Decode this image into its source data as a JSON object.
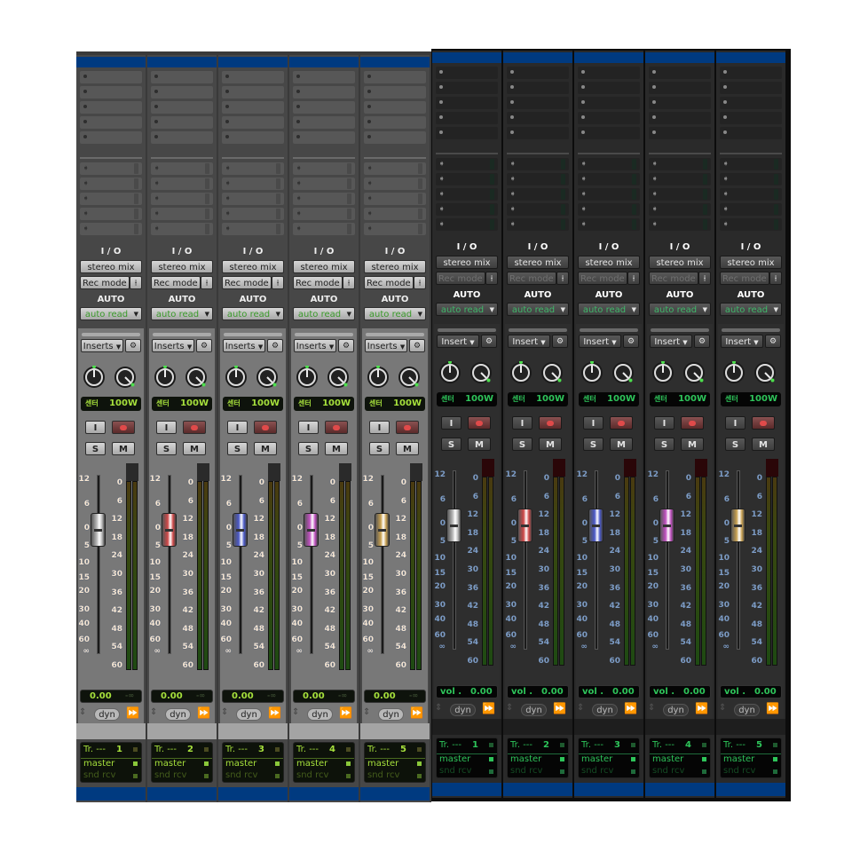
{
  "labels": {
    "io": "I / O",
    "output": "stereo mix",
    "rec_mode": "Rec mode",
    "auto": "AUTO",
    "auto_mode": "auto read",
    "inserts_light": "Inserts",
    "inserts_dark": "Insert",
    "input_button": "I",
    "solo": "S",
    "mute": "M",
    "dyn": "dyn",
    "track_prefix": "Tr. ---",
    "master": "master",
    "snd_rcv": "snd  rcv",
    "vol_prefix": "vol .",
    "neg_inf": "-∞"
  },
  "fader_scale": [
    "12",
    "6",
    "0",
    "5",
    "10",
    "15",
    "20",
    "30",
    "40",
    "60",
    "∞"
  ],
  "meter_scale": [
    "0",
    "6",
    "12",
    "18",
    "24",
    "30",
    "36",
    "42",
    "48",
    "54",
    "60"
  ],
  "panels": [
    {
      "theme": "light",
      "strips": [
        {
          "track": "1",
          "pan_label": "센터",
          "pan_value": "100W",
          "volume": "0.00",
          "fader_color": "#b8b8b8",
          "fader_db": 0
        },
        {
          "track": "2",
          "pan_label": "센터",
          "pan_value": "100W",
          "volume": "0.00",
          "fader_color": "#d04848",
          "fader_db": 0
        },
        {
          "track": "3",
          "pan_label": "센터",
          "pan_value": "100W",
          "volume": "0.00",
          "fader_color": "#4a58c8",
          "fader_db": 0
        },
        {
          "track": "4",
          "pan_label": "센터",
          "pan_value": "100W",
          "volume": "0.00",
          "fader_color": "#c050c0",
          "fader_db": 0
        },
        {
          "track": "5",
          "pan_label": "센터",
          "pan_value": "100W",
          "volume": "0.00",
          "fader_color": "#c8a050",
          "fader_db": 0
        }
      ]
    },
    {
      "theme": "dark",
      "strips": [
        {
          "track": "1",
          "pan_label": "센터",
          "pan_value": "100W",
          "volume": "0.00",
          "fader_color": "#b8b8b8",
          "fader_db": 0
        },
        {
          "track": "2",
          "pan_label": "센터",
          "pan_value": "100W",
          "volume": "0.00",
          "fader_color": "#d04848",
          "fader_db": 0
        },
        {
          "track": "3",
          "pan_label": "센터",
          "pan_value": "100W",
          "volume": "0.00",
          "fader_color": "#4a58c8",
          "fader_db": 0
        },
        {
          "track": "4",
          "pan_label": "센터",
          "pan_value": "100W",
          "volume": "0.00",
          "fader_color": "#c050c0",
          "fader_db": 0
        },
        {
          "track": "5",
          "pan_label": "센터",
          "pan_value": "100W",
          "volume": "0.00",
          "fader_color": "#c8a050",
          "fader_db": 0
        }
      ]
    }
  ]
}
